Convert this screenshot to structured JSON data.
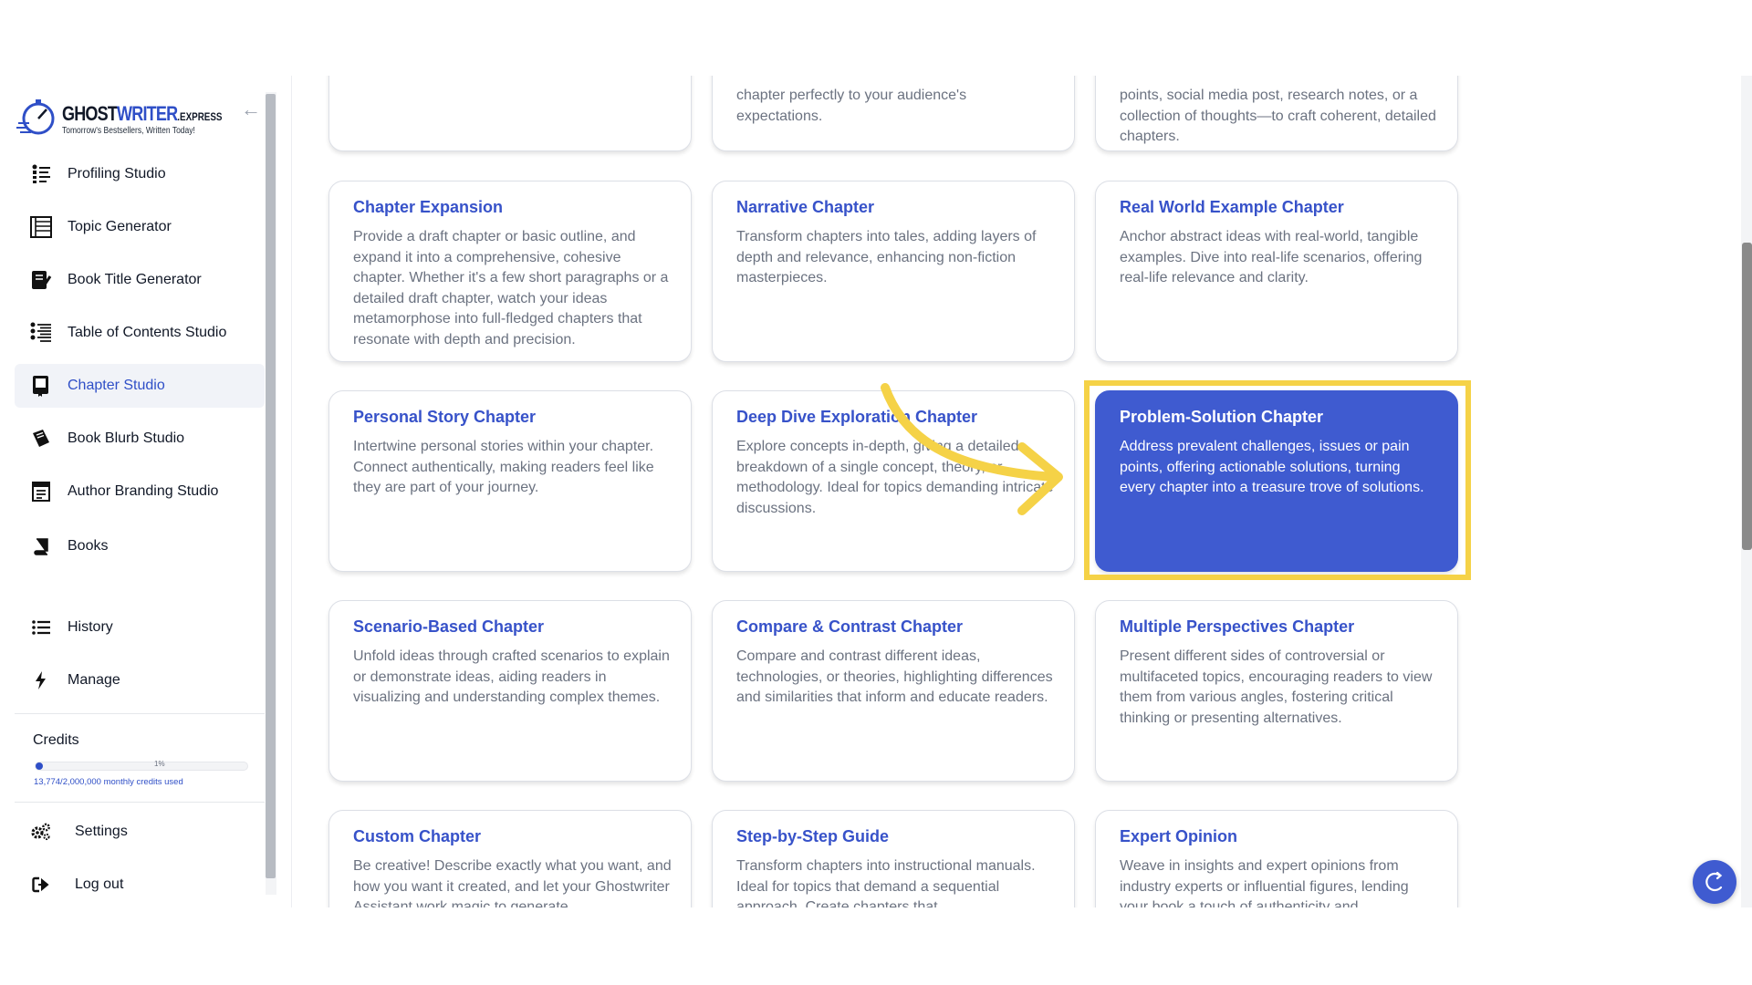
{
  "sidebar": {
    "logo": {
      "brand_a": "GHOST",
      "brand_b": "WRITER",
      "brand_c": ".EXPRESS",
      "tagline": "Tomorrow's Bestsellers, Written Today!"
    },
    "collapse_icon": "arrow-left-icon",
    "items": [
      {
        "label": "Profiling Studio",
        "icon": "profiling-icon"
      },
      {
        "label": "Topic Generator",
        "icon": "topic-icon"
      },
      {
        "label": "Book Title Generator",
        "icon": "book-title-icon"
      },
      {
        "label": "Table of Contents Studio",
        "icon": "toc-icon"
      },
      {
        "label": "Chapter Studio",
        "icon": "chapter-icon",
        "active": true
      },
      {
        "label": "Book Blurb Studio",
        "icon": "blurb-icon"
      },
      {
        "label": "Author Branding Studio",
        "icon": "branding-icon"
      },
      {
        "label": "Books",
        "icon": "books-icon"
      }
    ],
    "secondary": [
      {
        "label": "History",
        "icon": "list-icon"
      },
      {
        "label": "Manage",
        "icon": "bolt-icon"
      }
    ],
    "credits": {
      "title": "Credits",
      "percent_label": "1%",
      "used_fraction": 0.0069,
      "used_text": "13,774/2,000,000 monthly credits used"
    },
    "footer": [
      {
        "label": "Settings",
        "icon": "gears-icon"
      },
      {
        "label": "Log out",
        "icon": "logout-icon"
      }
    ]
  },
  "cards": {
    "row0": [
      {
        "title": "",
        "desc": ""
      },
      {
        "title": "",
        "desc": "chapter perfectly to your audience's expectations."
      },
      {
        "title": "",
        "desc": "points, social media post, research notes, or a collection of thoughts—to craft coherent, detailed chapters."
      }
    ],
    "row1": [
      {
        "title": "Chapter Expansion",
        "desc": "Provide a draft chapter or basic outline, and expand it into a comprehensive, cohesive chapter. Whether it's a few short paragraphs or a detailed draft chapter, watch your ideas metamorphose into full-fledged chapters that resonate with depth and precision."
      },
      {
        "title": "Narrative Chapter",
        "desc": "Transform chapters into tales, adding layers of depth and relevance, enhancing non-fiction masterpieces."
      },
      {
        "title": "Real World Example Chapter",
        "desc": "Anchor abstract ideas with real-world, tangible examples. Dive into real-life scenarios, offering real-life relevance and clarity."
      }
    ],
    "row2": [
      {
        "title": "Personal Story Chapter",
        "desc": "Intertwine personal stories within your chapter. Connect authentically, making readers feel like they are part of your journey."
      },
      {
        "title": "Deep Dive Exploration Chapter",
        "desc": "Explore concepts in-depth, giving a detailed breakdown of a single concept, theory, or methodology. Ideal for topics demanding intricate discussions."
      },
      {
        "title": "Problem-Solution Chapter",
        "desc": "Address prevalent challenges, issues or pain points, offering actionable solutions, turning every chapter into a treasure trove of solutions.",
        "selected": true
      }
    ],
    "row3": [
      {
        "title": "Scenario-Based Chapter",
        "desc": "Unfold ideas through crafted scenarios to explain or demonstrate ideas, aiding readers in visualizing and understanding complex themes."
      },
      {
        "title": "Compare & Contrast Chapter",
        "desc": "Compare and contrast different ideas, technologies, or theories, highlighting differences and similarities that inform and educate readers."
      },
      {
        "title": "Multiple Perspectives Chapter",
        "desc": "Present different sides of controversial or multifaceted topics, encouraging readers to view them from various angles, fostering critical thinking or presenting alternatives."
      }
    ],
    "row4": [
      {
        "title": "Custom Chapter",
        "desc": "Be creative! Describe exactly what you want, and how you want it created, and let your Ghostwriter Assistant work magic to generate"
      },
      {
        "title": "Step-by-Step Guide",
        "desc": "Transform chapters into instructional manuals. Ideal for topics that demand a sequential approach. Create chapters that"
      },
      {
        "title": "Expert Opinion",
        "desc": "Weave in insights and expert opinions from industry experts or influential figures, lending your book a touch of authenticity and"
      }
    ]
  },
  "fab": {
    "icon": "support-icon"
  },
  "colors": {
    "accent": "#3752c9",
    "selected_bg": "#3f5bd0",
    "highlight": "#f5d247"
  }
}
